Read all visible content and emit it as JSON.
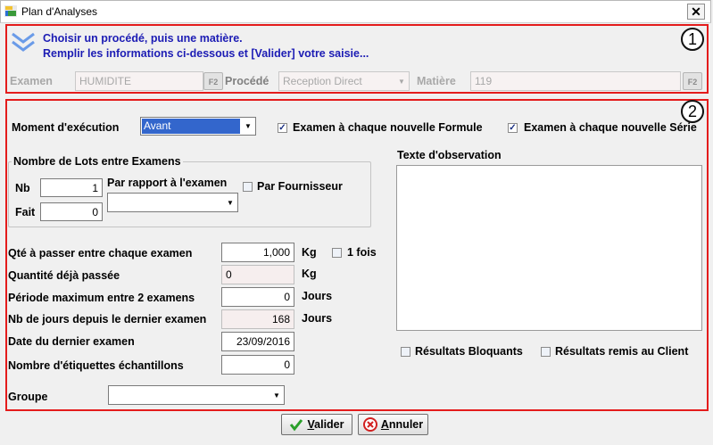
{
  "window": {
    "title": "Plan d'Analyses"
  },
  "header": {
    "line1": "Choisir un procédé, puis une matière.",
    "line2": "Remplir les informations ci-dessous et [Valider] votre saisie...",
    "badge1": "1",
    "badge2": "2"
  },
  "selection": {
    "examen_label": "Examen",
    "examen_value": "HUMIDITE",
    "procede_label": "Procédé",
    "procede_value": "Reception Direct",
    "matiere_label": "Matière",
    "matiere_value": "119",
    "f2": "F2"
  },
  "moment": {
    "label": "Moment d'exécution",
    "value": "Avant",
    "chk_formule": "Examen à chaque nouvelle Formule",
    "chk_serie": "Examen à chaque nouvelle Série"
  },
  "lots": {
    "group_title": "Nombre de Lots entre Examens",
    "nb_label": "Nb",
    "nb_value": "1",
    "fait_label": "Fait",
    "fait_value": "0",
    "par_rapport_label": "Par rapport à l'examen",
    "par_fournisseur_label": "Par Fournisseur"
  },
  "quantities": {
    "qte_label": "Qté à passer entre chaque examen",
    "qte_value": "1,000",
    "qte_unit": "Kg",
    "une_fois_label": "1 fois",
    "deja_label": "Quantité déjà passée",
    "deja_value": "0",
    "deja_unit": "Kg",
    "periode_label": "Période maximum entre 2 examens",
    "periode_value": "0",
    "periode_unit": "Jours",
    "nbjours_label": "Nb de jours depuis le dernier examen",
    "nbjours_value": "168",
    "nbjours_unit": "Jours",
    "date_label": "Date du dernier examen",
    "date_value": "23/09/2016",
    "etiquettes_label": "Nombre d'étiquettes échantillons",
    "etiquettes_value": "0",
    "groupe_label": "Groupe"
  },
  "observation": {
    "label": "Texte d'observation"
  },
  "results": {
    "bloquants_label": "Résultats Bloquants",
    "remis_label": "Résultats remis au Client"
  },
  "buttons": {
    "valider_u": "V",
    "valider_rest": "alider",
    "annuler_u": "A",
    "annuler_rest": "nnuler"
  },
  "colors": {
    "accent_blue": "#1c1cb4",
    "highlight": "#3366cc",
    "frame_red": "#e41c1c"
  }
}
